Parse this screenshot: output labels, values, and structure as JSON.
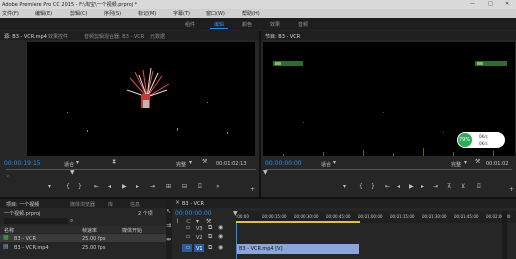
{
  "window": {
    "title": "Adobe Premiere Pro CC 2015 - F:\\淘宝\\一个视频.prproj *",
    "min": "—",
    "max": "□",
    "close": "✕"
  },
  "menu": [
    "文件(F)",
    "编辑(E)",
    "剪辑(C)",
    "序列(S)",
    "标记(M)",
    "字幕(T)",
    "窗口(W)",
    "帮助(H)"
  ],
  "workspaces": [
    {
      "label": "组件",
      "active": false
    },
    {
      "label": "编辑",
      "active": true
    },
    {
      "label": "颜色",
      "active": false
    },
    {
      "label": "效果",
      "active": false
    },
    {
      "label": "音频",
      "active": false
    }
  ],
  "source_tabs": [
    "源: B3 - VCR.mp4",
    "效果控件",
    "音频剪辑混合器: B3 - VCR",
    "元数据"
  ],
  "program_tab": "节目: B3 - VCR",
  "source": {
    "timecode": "00:00:19:15",
    "fit": "适合",
    "duration": "00:01:02:13",
    "full": "完整"
  },
  "program": {
    "timecode": "00:00:00:00",
    "fit": "适合",
    "full": "完整",
    "duration": "00:01:02"
  },
  "stats": {
    "pct": "79%",
    "up": "0K/s",
    "down": "0K/s"
  },
  "project": {
    "tabs": [
      "项目: 一个视频",
      "媒体浏览器",
      "库",
      "信息"
    ],
    "name": "一个视频.prproj",
    "count": "2 个项",
    "headers": [
      "名称",
      "帧速率",
      "媒体开始"
    ],
    "items": [
      {
        "name": "B3 - VCR",
        "rate": "25.00 fps",
        "selected": true
      },
      {
        "name": "B3 - VCR.mp4",
        "rate": "25.00 fps",
        "selected": false
      }
    ]
  },
  "timeline": {
    "tab": "B3 - VCR",
    "timecode": "00:00:00:00",
    "ruler": [
      ":00:00",
      "00:00:15:00",
      "00:00:30:00",
      "00:00:45:00",
      "00:01:00:00",
      "00:01:15:00",
      "00:01:30:00",
      "00:01:45:00",
      "00:02:00:00"
    ],
    "tracks": [
      "V3",
      "V2",
      "V1"
    ],
    "clip": "B3 - VCR.mp4 [V]"
  },
  "colors": {
    "accent": "#2d8ceb",
    "clip": "#8aa5d6",
    "badge": "#2eaa5a"
  },
  "icons": [
    "play-icon",
    "step-back-icon",
    "step-forward-icon",
    "wrench-icon",
    "plus-icon",
    "lock-icon",
    "eye-icon",
    "camera-icon",
    "export-frame-icon"
  ]
}
